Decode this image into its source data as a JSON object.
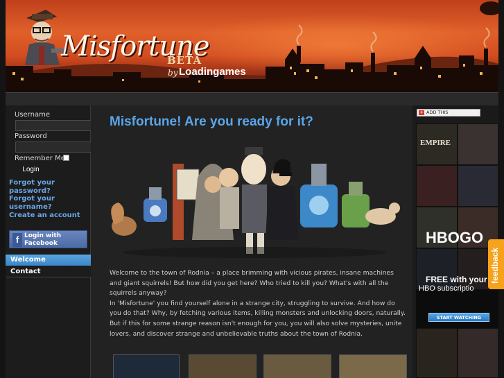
{
  "banner": {
    "logo_text": "Misfortune",
    "beta": "BETA",
    "by": "by",
    "brand": "Loadingames"
  },
  "login": {
    "username_label": "Username",
    "password_label": "Password",
    "remember_label": "Remember Me",
    "login_button": "Login",
    "forgot_password": "Forgot your password?",
    "forgot_username": "Forgot your username?",
    "create_account": "Create an account",
    "facebook_line1": "Login with",
    "facebook_line2": "Facebook",
    "facebook_letter": "f"
  },
  "nav": {
    "welcome": "Welcome",
    "contact": "Contact"
  },
  "main": {
    "title": "Misfortune! Are you ready for it?",
    "para1": "Welcome to the town of Rodnia – a place brimming with vicious pirates, insane machines and giant squirrels! But how did you get here? Who tried to kill you? What's with all the squirrels anyway?",
    "para2": "In 'Misfortune' you find yourself alone in a strange city, struggling to survive. And how do you do that? Why, by fetching various items, killing monsters and unlocking doors, naturally. But if this for some strange reason isn't enough for you, you will also solve mysteries, unite lovers, and discover strange and unbelievable truths about the town of Rodnia."
  },
  "share": {
    "label": "ADD THIS",
    "plus": "+"
  },
  "ad": {
    "empire": "EMPIRE",
    "brand": "HBOGO",
    "free": "FREE with your",
    "subscription": "HBO subscriptio",
    "cta": "START WATCHING"
  },
  "feedback": {
    "label": "feedback"
  },
  "colors": {
    "accent": "#5aa6e8",
    "nav_active": "#3a86c8",
    "feedback": "#f6a21b"
  }
}
